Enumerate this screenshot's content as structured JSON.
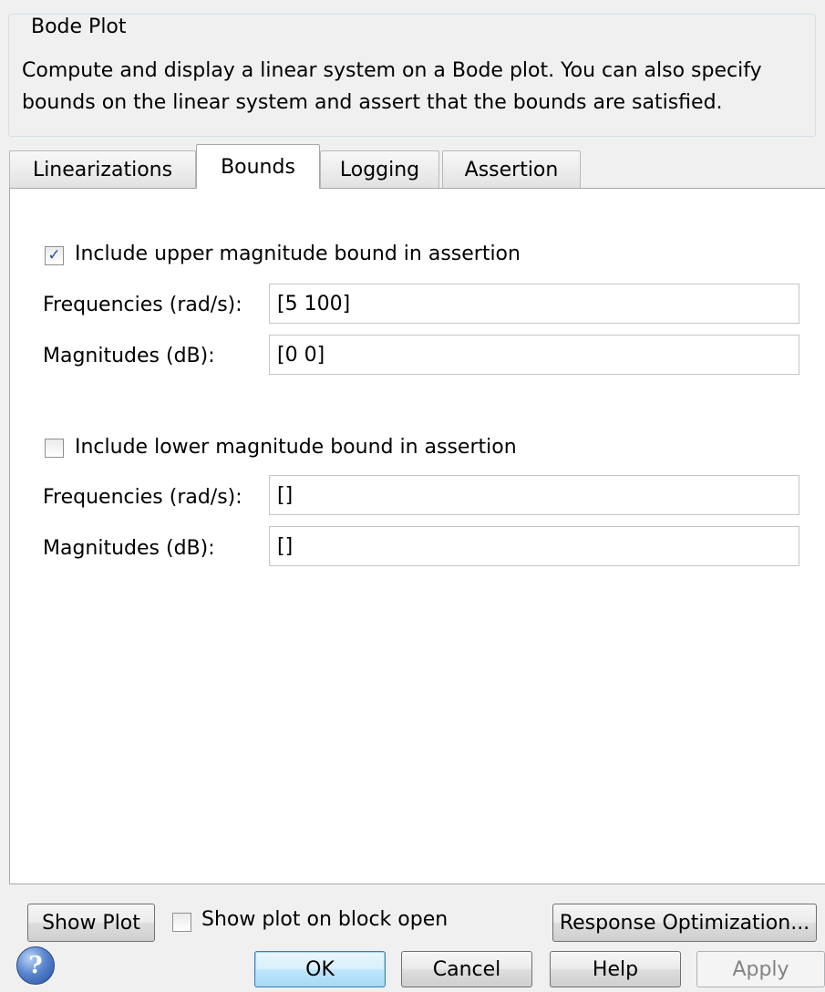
{
  "group": {
    "title": "Bode Plot",
    "description_line1": "Compute and display a linear system on a Bode plot. You can also specify",
    "description_line2": "bounds on the linear system and assert that the bounds are satisfied."
  },
  "tabs": [
    {
      "label": "Linearizations",
      "active": false
    },
    {
      "label": "Bounds",
      "active": true
    },
    {
      "label": "Logging",
      "active": false
    },
    {
      "label": "Assertion",
      "active": false
    }
  ],
  "upper_bound": {
    "checkbox_label": "Include upper magnitude bound in assertion",
    "checked": true,
    "freq_label": "Frequencies (rad/s):",
    "freq_value": "[5 100]",
    "mag_label": "Magnitudes (dB):",
    "mag_value": "[0 0]"
  },
  "lower_bound": {
    "checkbox_label": "Include lower magnitude bound in assertion",
    "checked": false,
    "freq_label": "Frequencies (rad/s):",
    "freq_value": "[]",
    "mag_label": "Magnitudes (dB):",
    "mag_value": "[]"
  },
  "plot_row": {
    "show_plot_label": "Show Plot",
    "show_on_open_label": "Show plot on block open",
    "show_on_open_checked": false,
    "response_opt_label": "Response Optimization..."
  },
  "footer": {
    "help_glyph": "?",
    "ok_label": "OK",
    "cancel_label": "Cancel",
    "help_label": "Help",
    "apply_label": "Apply"
  },
  "check_glyph": "✓"
}
